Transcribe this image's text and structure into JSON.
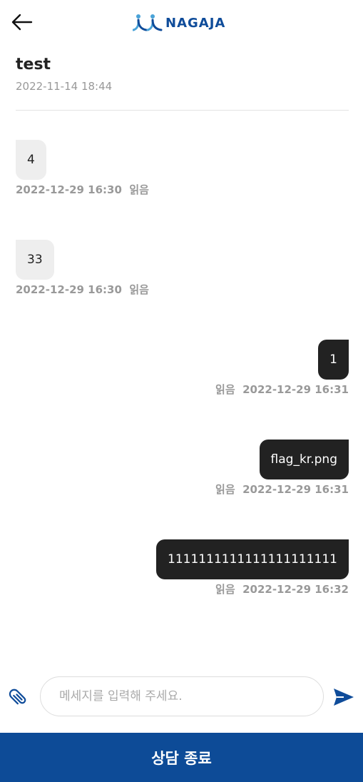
{
  "header": {
    "brand": "NAGAJA",
    "title": "test",
    "date": "2022-11-14 18:44"
  },
  "messages": [
    {
      "direction": "in",
      "text": "4",
      "time": "2022-12-29 16:30",
      "status": "읽음"
    },
    {
      "direction": "in",
      "text": "33",
      "time": "2022-12-29 16:30",
      "status": "읽음"
    },
    {
      "direction": "out",
      "text": "1",
      "time": "2022-12-29 16:31",
      "status": "읽음"
    },
    {
      "direction": "out",
      "text": "flag_kr.png",
      "time": "2022-12-29 16:31",
      "status": "읽음"
    },
    {
      "direction": "out",
      "text": "1111111111111111111111",
      "time": "2022-12-29 16:32",
      "status": "읽음"
    }
  ],
  "composer": {
    "placeholder": "메세지를 입력해 주세요.",
    "value": ""
  },
  "end_button": "상담 종료",
  "colors": {
    "brand": "#0f4c9a",
    "end_bar": "#0d4b97",
    "out_bubble": "#222222",
    "in_bubble": "#eeeeee"
  },
  "icons": {
    "back": "arrow-left-icon",
    "attach": "paperclip-icon",
    "send": "send-icon",
    "logo": "nagaja-logo-icon"
  }
}
